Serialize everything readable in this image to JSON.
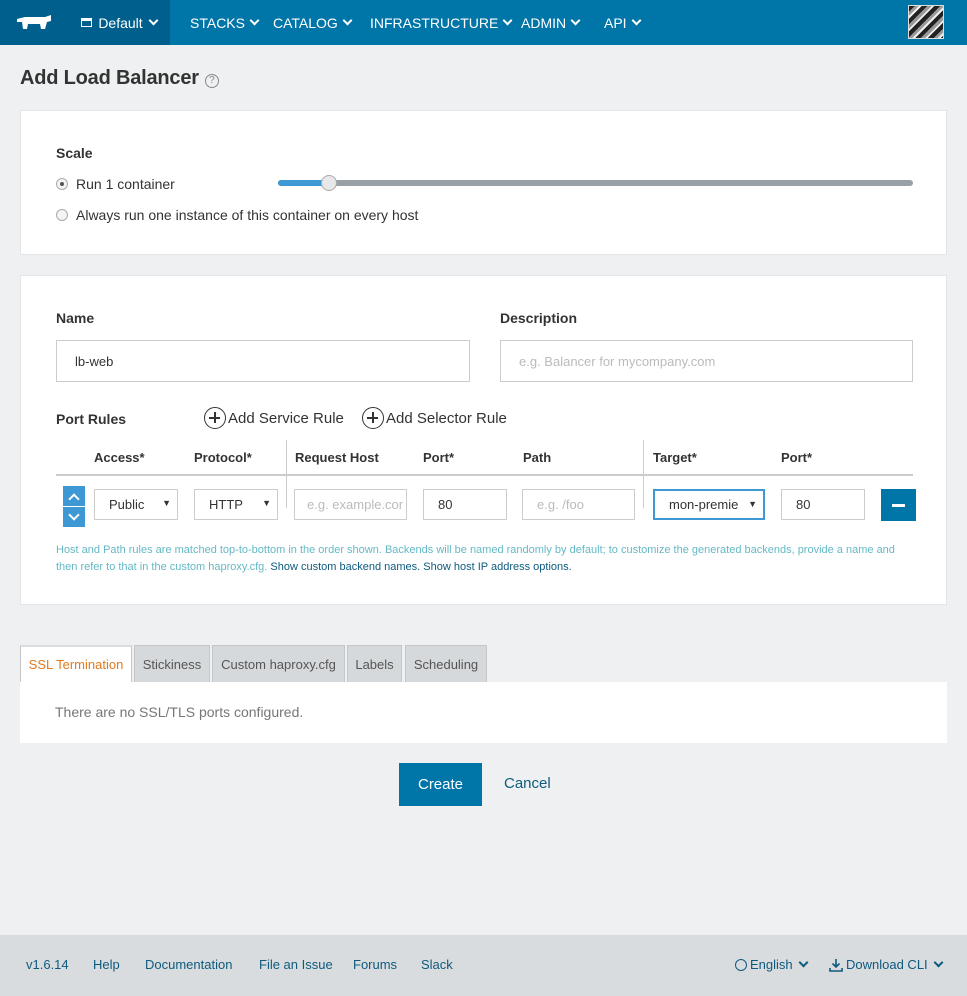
{
  "nav": {
    "environment": "Default",
    "items": [
      "STACKS",
      "CATALOG",
      "INFRASTRUCTURE",
      "ADMIN",
      "API"
    ]
  },
  "page": {
    "title": "Add Load Balancer"
  },
  "scale": {
    "label": "Scale",
    "option_run": "Run 1 container",
    "option_every_host": "Always run one instance of this container on every host",
    "selected": "run",
    "slider_fraction": 0.08
  },
  "form": {
    "name_label": "Name",
    "name_value": "lb-web",
    "description_label": "Description",
    "description_placeholder": "e.g. Balancer for mycompany.com"
  },
  "port_rules": {
    "label": "Port Rules",
    "add_service_rule": "Add Service Rule",
    "add_selector_rule": "Add Selector Rule",
    "columns": {
      "access": "Access*",
      "protocol": "Protocol*",
      "request_host": "Request Host",
      "port": "Port*",
      "path": "Path",
      "target": "Target*",
      "target_port": "Port*"
    },
    "row": {
      "access": "Public",
      "protocol": "HTTP",
      "request_host_placeholder": "e.g. example.cor",
      "port": "80",
      "path_placeholder": "e.g. /foo",
      "target": "mon-premie",
      "target_port": "80"
    },
    "note": "Host and Path rules are matched top-to-bottom in the order shown. Backends will be named randomly by default; to customize the generated backends, provide a name and then refer to that in the custom haproxy.cfg.",
    "note_link1": "Show custom backend names.",
    "note_link2": "Show host IP address options."
  },
  "tabs": [
    "SSL Termination",
    "Stickiness",
    "Custom haproxy.cfg",
    "Labels",
    "Scheduling"
  ],
  "ssl": {
    "empty": "There are no SSL/TLS ports configured."
  },
  "actions": {
    "create": "Create",
    "cancel": "Cancel"
  },
  "footer": {
    "version": "v1.6.14",
    "help": "Help",
    "documentation": "Documentation",
    "file_issue": "File an Issue",
    "forums": "Forums",
    "slack": "Slack",
    "language": "English",
    "download": "Download CLI"
  },
  "colors": {
    "nav": "#0075a8",
    "accent": "#3d98d3",
    "active_tab": "#e07b21"
  }
}
